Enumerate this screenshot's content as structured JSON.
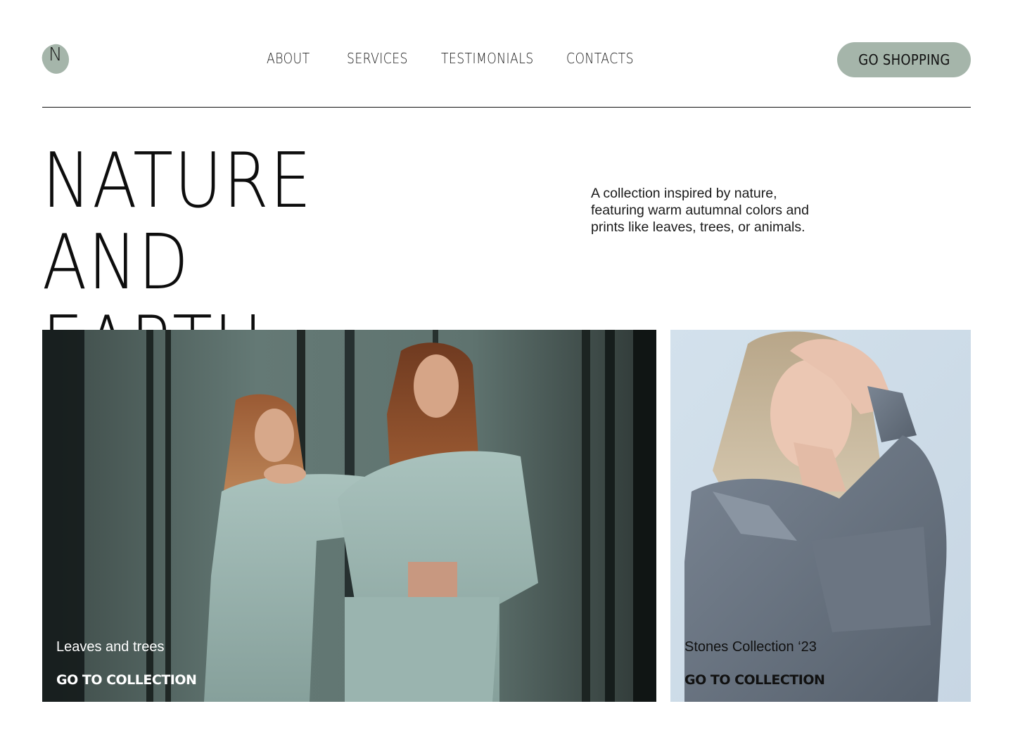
{
  "brand": {
    "logo_letter": "N",
    "logo_color": "#a5b5aa"
  },
  "nav": {
    "items": [
      {
        "label": "ABOUT"
      },
      {
        "label": "SERVICES"
      },
      {
        "label": "TESTIMONIALS"
      },
      {
        "label": "CONTACTS"
      }
    ],
    "cta_label": "GO SHOPPING"
  },
  "hero": {
    "title_line1": "NATURE AND",
    "title_line2": "EARTH TONES",
    "description": "A collection inspired by nature, featuring warm autumnal colors and prints like leaves, trees, or animals."
  },
  "collections": [
    {
      "label": "Leaves and trees",
      "link_label": "GO TO COLLECTION",
      "photo": "two-women-in-sage-suits-photo",
      "text_color": "#ffffff"
    },
    {
      "label": "Stones Collection ‘23",
      "link_label": "GO TO COLLECTION",
      "photo": "woman-in-grey-shirt-photo",
      "text_color": "#111111"
    }
  ],
  "colors": {
    "accent": "#a5b5aa",
    "text": "#111111",
    "background": "#ffffff"
  }
}
